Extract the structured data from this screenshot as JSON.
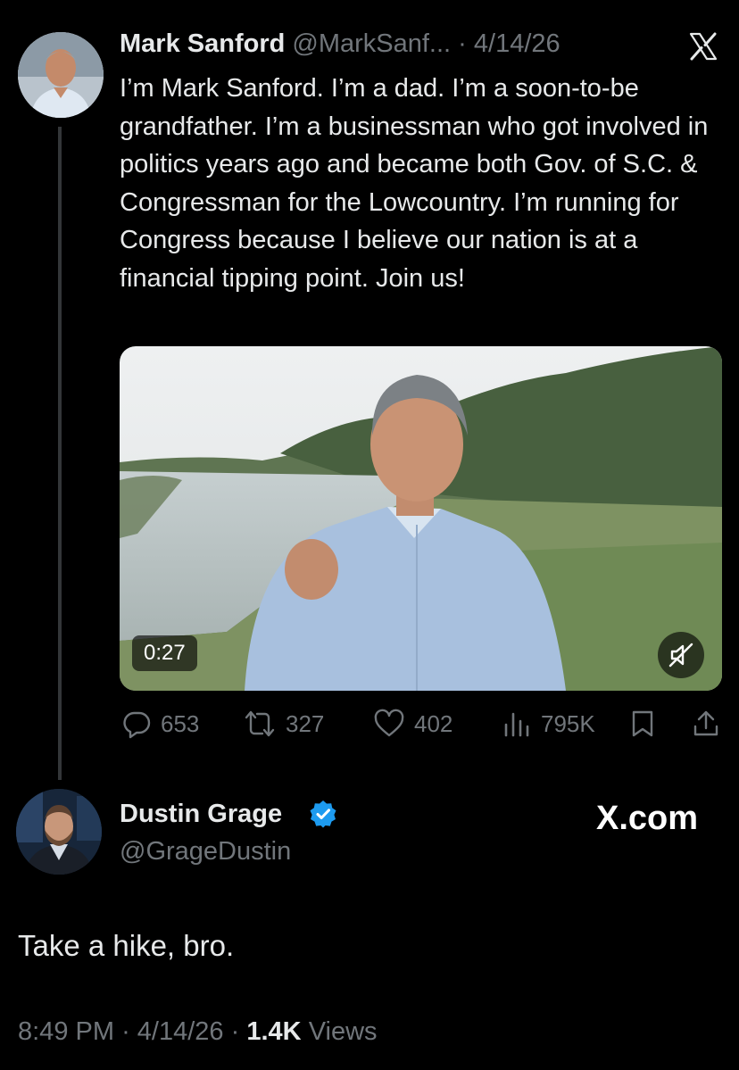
{
  "parent_tweet": {
    "author_name": "Mark Sanford",
    "author_handle": "@MarkSanf...",
    "separator": "·",
    "date": "4/14/26",
    "text": "I’m Mark Sanford. I’m a dad. I’m a soon-to-be grandfather. I’m a businessman who got involved in politics years ago and became both Gov. of S.C. & Congressman for the Lowcountry. I’m running for Congress because I believe our nation is at a financial tipping point. Join us!",
    "video": {
      "duration": "0:27",
      "muted": true
    },
    "stats": {
      "replies": "653",
      "reposts": "327",
      "likes": "402",
      "views": "795K"
    }
  },
  "reply_tweet": {
    "author_name": "Dustin Grage",
    "author_handle": "@GrageDustin",
    "verified": true,
    "brand": "X.com",
    "text": "Take a hike, bro.",
    "time": "8:49 PM",
    "separator": "·",
    "date": "4/14/26",
    "views_count": "1.4K",
    "views_label": "Views"
  },
  "colors": {
    "background": "#000000",
    "text": "#e7e9ea",
    "muted": "#71767b",
    "verified": "#1d9bf0"
  },
  "icons": [
    "x-logo-icon",
    "mute-icon",
    "reply-icon",
    "repost-icon",
    "like-icon",
    "views-icon",
    "bookmark-icon",
    "share-icon",
    "verified-badge-icon"
  ]
}
